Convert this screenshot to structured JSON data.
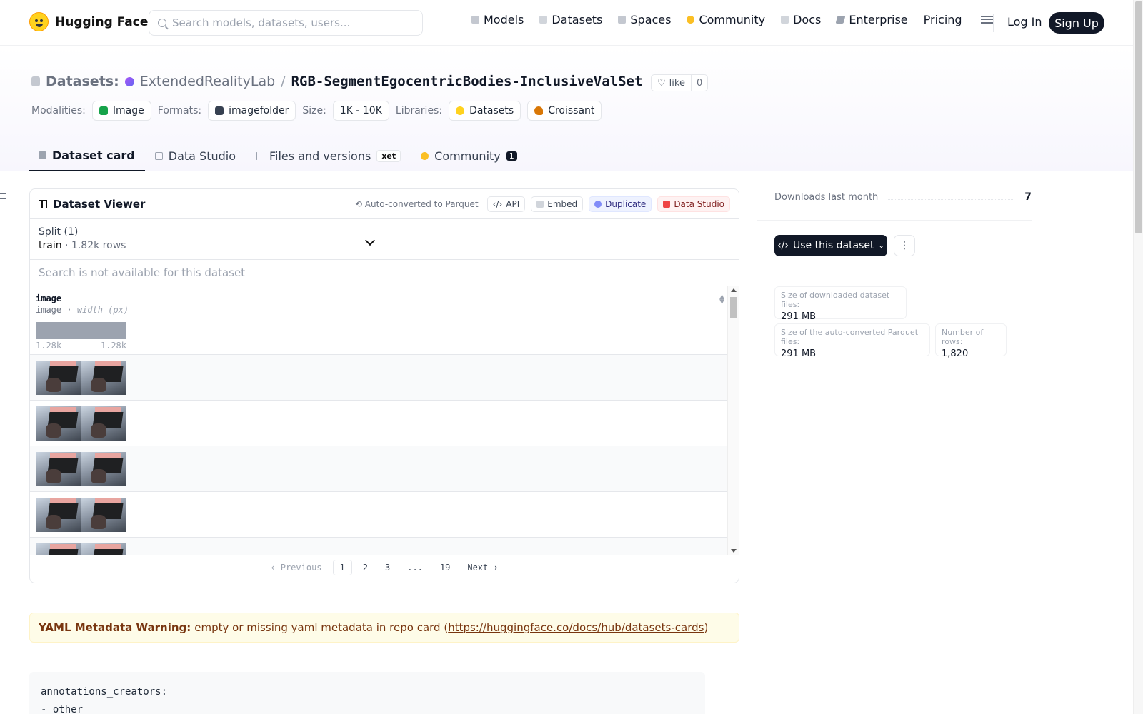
{
  "nav": {
    "brand": "Hugging Face",
    "search_placeholder": "Search models, datasets, users...",
    "links": [
      {
        "label": "Models",
        "icon": "cube-icon",
        "color": "#9ca3af"
      },
      {
        "label": "Datasets",
        "icon": "database-icon",
        "color": "#c4c8d0"
      },
      {
        "label": "Spaces",
        "icon": "spaces-icon",
        "color": "#b8bcc4"
      },
      {
        "label": "Community",
        "icon": "community-icon",
        "color": "#fbbf24"
      },
      {
        "label": "Docs",
        "icon": "book-icon",
        "color": "#b8bcc4"
      },
      {
        "label": "Enterprise",
        "icon": "enterprise-icon",
        "color": "#9ca3af"
      },
      {
        "label": "Pricing"
      }
    ],
    "login": "Log In",
    "signup": "Sign Up"
  },
  "header": {
    "section": "Datasets:",
    "org": "ExtendedRealityLab",
    "separator": "/",
    "repo": "RGB-SegmentEgocentricBodies-InclusiveValSet",
    "like_label": "like",
    "like_count": "0",
    "modalities_label": "Modalities:",
    "modality": "Image",
    "formats_label": "Formats:",
    "format": "imagefolder",
    "size_label": "Size:",
    "size": "1K - 10K",
    "libraries_label": "Libraries:",
    "libraries": [
      "Datasets",
      "Croissant"
    ]
  },
  "tabs": [
    {
      "label": "Dataset card",
      "active": true
    },
    {
      "label": "Data Studio"
    },
    {
      "label": "Files and versions",
      "badge": "xet"
    },
    {
      "label": "Community",
      "count": "1"
    }
  ],
  "viewer": {
    "title": "Dataset Viewer",
    "autoconv_link": "Auto-converted",
    "autoconv_rest": " to Parquet",
    "buttons": [
      "API",
      "Embed",
      "Duplicate",
      "Data Studio"
    ],
    "split_label": "Split (1)",
    "split_name": "train",
    "split_dot": "·",
    "split_rows": "1.82k rows",
    "search_na": "Search is not available for this dataset",
    "column": {
      "name": "image",
      "type": "image",
      "type_sep": "·",
      "type_extra": "width (px)",
      "hist_min": "1.28k",
      "hist_max": "1.28k"
    },
    "row_count_visible": 5,
    "pager": {
      "prev": "‹  Previous",
      "pages": [
        "1",
        "2",
        "3",
        "...",
        "19"
      ],
      "current": "1",
      "next": "Next  ›"
    }
  },
  "warning": {
    "bold": "YAML Metadata Warning:",
    "text": " empty or missing yaml metadata in repo card (",
    "link": "https://huggingface.co/docs/hub/datasets-cards",
    "close": ")"
  },
  "code": {
    "line1": "annotations_creators:",
    "line2": "- other"
  },
  "sidebar": {
    "downloads_label": "Downloads last month",
    "downloads_value": "7",
    "use_button": "Use this dataset",
    "more": "⋮",
    "stats": [
      {
        "label": "Size of downloaded dataset files:",
        "value": "291 MB"
      },
      {
        "label": "Size of the auto-converted Parquet files:",
        "value": "291 MB"
      },
      {
        "label": "Number of rows:",
        "value": "1,820"
      }
    ]
  },
  "colors": {
    "brand_yellow": "#ffd21e",
    "dark": "#111827",
    "warning_bg": "#fefce8"
  }
}
